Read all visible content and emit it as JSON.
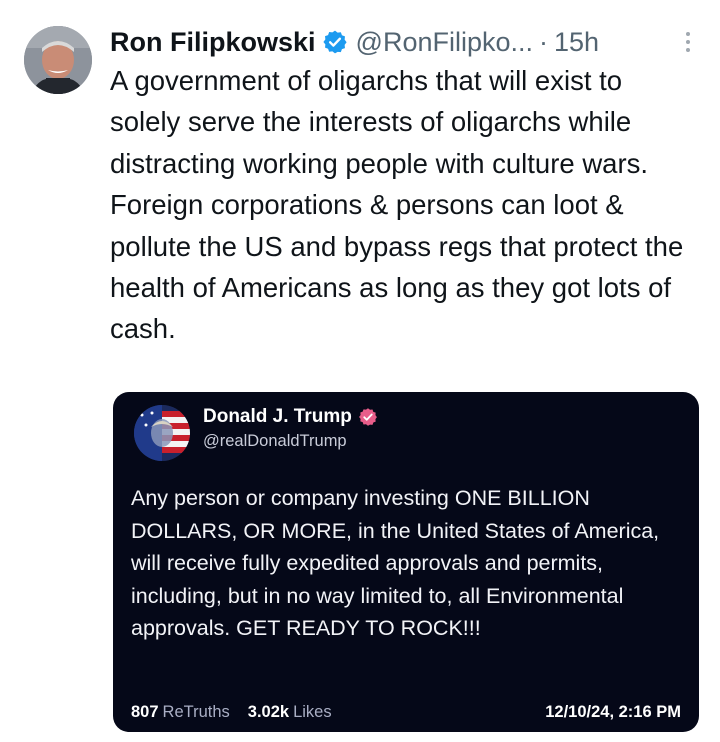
{
  "post": {
    "display_name": "Ron Filipkowski",
    "handle": "@RonFilipko...",
    "separator": "·",
    "time": "15h",
    "text": "A government of oligarchs that will exist to solely serve the interests of oligarchs while distracting working people with culture wars. Foreign corporations & persons can loot & pollute the US and bypass regs that protect the health of Americans as long as they got lots of cash.",
    "verified_icon": "verified-badge-icon",
    "verified_color": "#1d9bf0"
  },
  "quote": {
    "display_name": "Donald J. Trump",
    "handle": "@realDonaldTrump",
    "text": "Any person or company investing ONE BILLION DOLLARS, OR MORE, in the United States of America, will receive fully expedited approvals and permits, including, but in no way limited to, all Environmental approvals. GET READY TO ROCK!!!",
    "retruths_count": "807",
    "retruths_label": "ReTruths",
    "likes_count": "3.02k",
    "likes_label": "Likes",
    "date": "12/10/24, 2:16 PM",
    "verified_icon": "verified-badge-icon",
    "verified_color": "#e85d8a",
    "background_color": "#050818"
  }
}
